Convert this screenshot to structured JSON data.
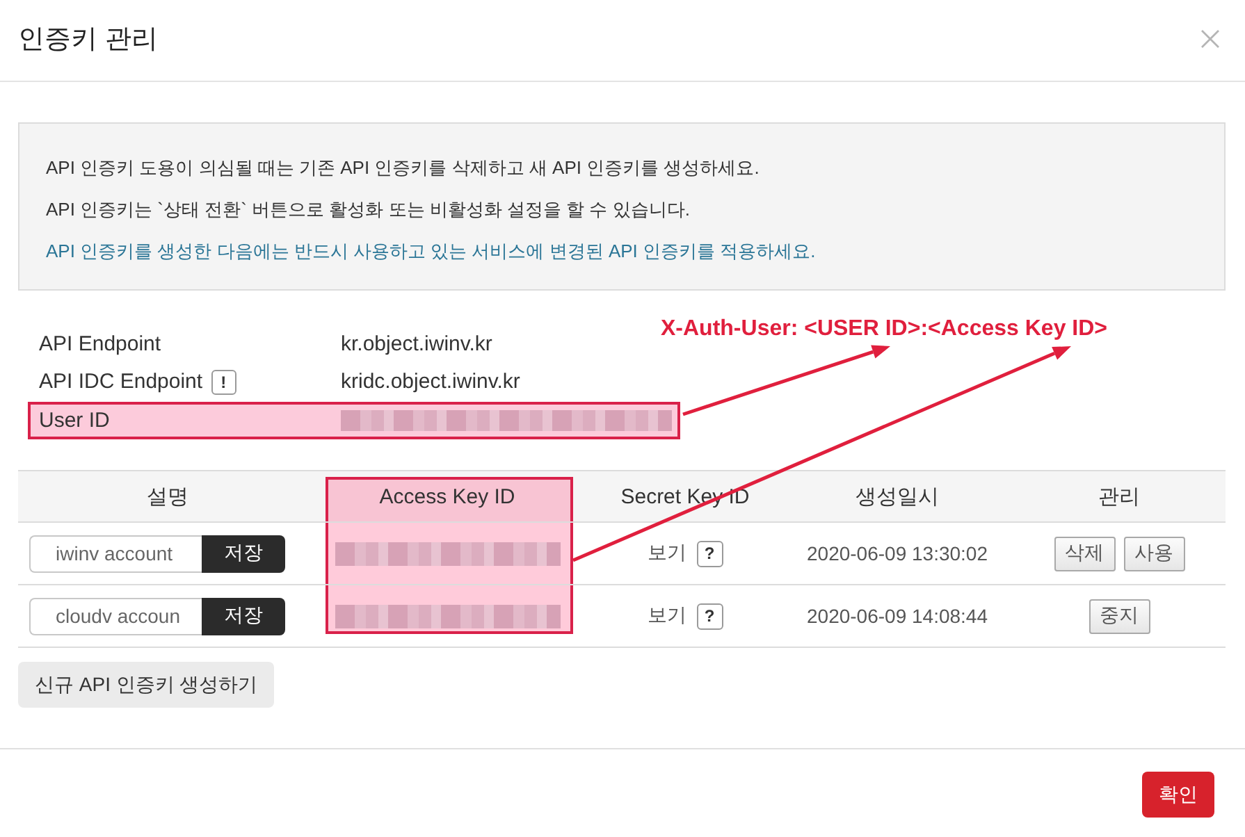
{
  "header": {
    "title": "인증키 관리"
  },
  "notice": {
    "lines": [
      {
        "text": "API 인증키 도용이 의심될 때는 기존 API 인증키를 삭제하고 새 API 인증키를 생성하세요.",
        "kind": "plain"
      },
      {
        "text": "API 인증키는 `상태 전환` 버튼으로 활성화 또는 비활성화 설정을 할 수 있습니다.",
        "kind": "plain"
      },
      {
        "text": "API 인증키를 생성한 다음에는 반드시 사용하고 있는 서비스에 변경된 API 인증키를 적용하세요.",
        "kind": "accent"
      }
    ]
  },
  "endpoints": [
    {
      "label": "API Endpoint",
      "value": "kr.object.iwinv.kr",
      "redacted": false,
      "highlighted": false
    },
    {
      "label": "API IDC Endpoint",
      "hint": "!",
      "value": "kridc.object.iwinv.kr",
      "redacted": false,
      "highlighted": false
    },
    {
      "label": "User ID",
      "redacted": true,
      "highlighted": true
    }
  ],
  "annotation": {
    "text": "X-Auth-User: <USER ID>:<Access Key ID>"
  },
  "table": {
    "columns": [
      {
        "label": "설명",
        "highlighted": false
      },
      {
        "label": "Access Key ID",
        "highlighted": true
      },
      {
        "label": "Secret Key ID",
        "highlighted": false
      },
      {
        "label": "생성일시",
        "highlighted": false
      },
      {
        "label": "관리",
        "highlighted": false
      }
    ],
    "rows": [
      {
        "description": "iwinv account",
        "save": "저장",
        "access_key_redacted": true,
        "secret": "보기",
        "secret_hint": "?",
        "created": "2020-06-09 13:30:02",
        "actions": [
          "삭제",
          "사용"
        ]
      },
      {
        "description": "cloudv accoun",
        "save": "저장",
        "access_key_redacted": true,
        "secret": "보기",
        "secret_hint": "?",
        "created": "2020-06-09 14:08:44",
        "actions": [
          "중지"
        ]
      }
    ]
  },
  "create_button": "신규 API 인증키 생성하기",
  "confirm_button": "확인"
}
